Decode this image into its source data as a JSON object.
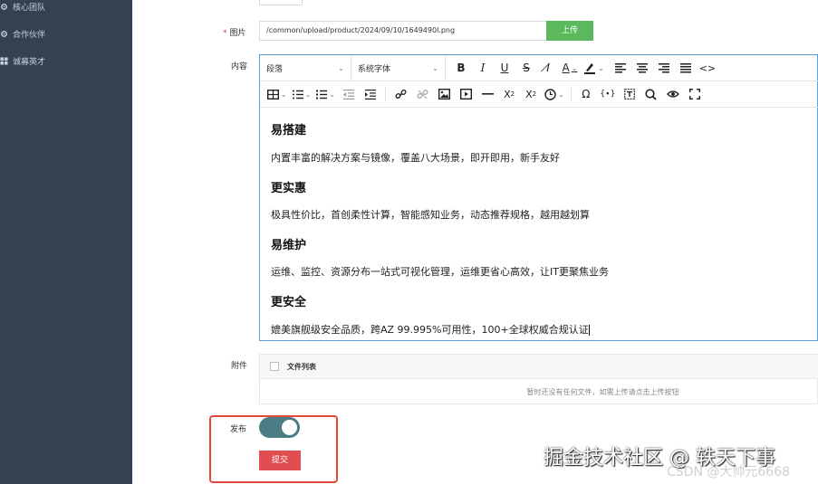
{
  "sidebar": {
    "items": [
      {
        "label": "核心团队",
        "icon": "gear-icon"
      },
      {
        "label": "合作伙伴",
        "icon": "gear-icon"
      },
      {
        "label": "诚募英才",
        "icon": "grid-icon"
      }
    ]
  },
  "form": {
    "image_label": "图片",
    "image_required_mark": "*",
    "image_path": "/common/upload/product/2024/09/10/1649490l.png",
    "upload_label": "上传",
    "content_label": "内容",
    "attachment_label": "附件",
    "publish_label": "发布",
    "publish_on": true,
    "submit_label": "提交"
  },
  "editor": {
    "paragraph_select": "段落",
    "font_select": "系统字体",
    "body": {
      "h1": "易搭建",
      "p1": "内置丰富的解决方案与镜像，覆盖八大场景，即开即用，新手友好",
      "h2": "更实惠",
      "p2": "极具性价比，首创柔性计算，智能感知业务，动态推荐规格，越用越划算",
      "h3": "易维护",
      "p3": "运维、监控、资源分布一站式可视化管理，运维更省心高效，让IT更聚焦业务",
      "h4": "更安全",
      "p4": "媲美旗舰级安全品质，跨AZ 99.995%可用性，100+全球权威合规认证"
    }
  },
  "attachment": {
    "header": "文件列表",
    "empty_text": "暂时还没有任何文件，如需上传请点击上传按钮"
  },
  "watermark": {
    "main": "掘金技术社区 @ 轶天下事",
    "sub": "CSDN @大帅元6668"
  },
  "colors": {
    "sidebar_bg": "#334152",
    "upload_btn": "#5cb85c",
    "toggle_on": "#4a7e84",
    "submit_btn": "#e04e52",
    "highlight": "#e0483a"
  }
}
